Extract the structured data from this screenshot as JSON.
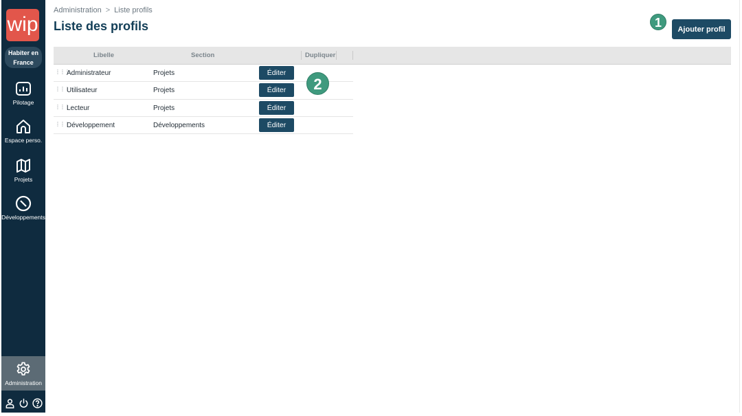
{
  "sidebar": {
    "logo_text": "wip",
    "org_lines": [
      "Habiter en",
      "France"
    ],
    "items": [
      {
        "label": "Pilotage",
        "icon": "chart-icon"
      },
      {
        "label": "Espace perso.",
        "icon": "home-icon"
      },
      {
        "label": "Projets",
        "icon": "map-icon"
      },
      {
        "label": "Développements",
        "icon": "compass-icon"
      },
      {
        "label": "Administration",
        "icon": "gear-icon"
      }
    ],
    "active_item": "Administration",
    "bottom_icons": [
      "user-icon",
      "power-icon",
      "help-icon"
    ]
  },
  "header": {
    "breadcrumb": [
      "Administration",
      "Liste profils"
    ],
    "breadcrumb_separator": ">",
    "title": "Liste des profils",
    "add_button_label": "Ajouter profil"
  },
  "annotations": [
    "1",
    "2"
  ],
  "table": {
    "columns": [
      "Libelle",
      "Section",
      "Dupliquer"
    ],
    "rows": [
      {
        "libelle": "Administrateur",
        "section": "Projets",
        "action": "Éditer"
      },
      {
        "libelle": "Utilisateur",
        "section": "Projets",
        "action": "Éditer"
      },
      {
        "libelle": "Lecteur",
        "section": "Projets",
        "action": "Éditer"
      },
      {
        "libelle": "Développement",
        "section": "Développements",
        "action": "Éditer"
      }
    ]
  },
  "colors": {
    "sidebar_bg": "#0f2b3f",
    "logo_bg": "#e2564b",
    "primary_button": "#1d4a64",
    "title": "#123e57",
    "badge": "#3f9a7e",
    "active_nav": "#5c6b75"
  }
}
